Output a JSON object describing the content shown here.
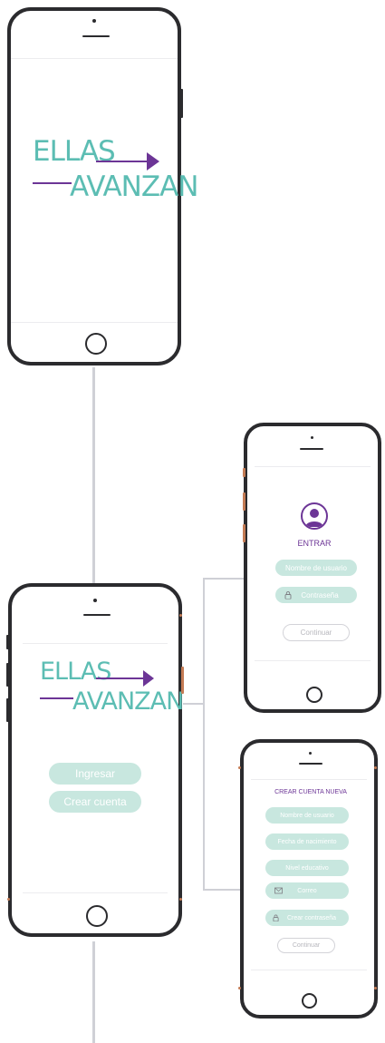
{
  "splash": {
    "logo": {
      "word_top": "ELLAS",
      "word_bottom": "AVANZAN"
    }
  },
  "home": {
    "logo": {
      "word_top": "ELLAS",
      "word_bottom": "AVANZAN"
    },
    "login_button": "Ingresar",
    "create_account_button": "Crear cuenta"
  },
  "login": {
    "title": "ENTRAR",
    "username_placeholder": "Nombre de usuario",
    "password_placeholder": "Contraseña",
    "continue_button": "Continuar",
    "avatar_icon": "user-icon",
    "password_icon": "lock-icon"
  },
  "register": {
    "title": "CREAR CUENTA NUEVA",
    "fields": [
      "Nombre de usuario",
      "Fecha de nacimiento",
      "Nivel educativo",
      "Correo",
      "Crear contraseña"
    ],
    "email_icon": "envelope-icon",
    "password_icon": "lock-icon",
    "continue_button": "Continuar"
  },
  "colors": {
    "teal": "#5cbdb3",
    "pill_fill": "#c8e7df",
    "purple": "#6c3596",
    "frame": "#2b2b2e",
    "connector": "#cfd0d6"
  }
}
